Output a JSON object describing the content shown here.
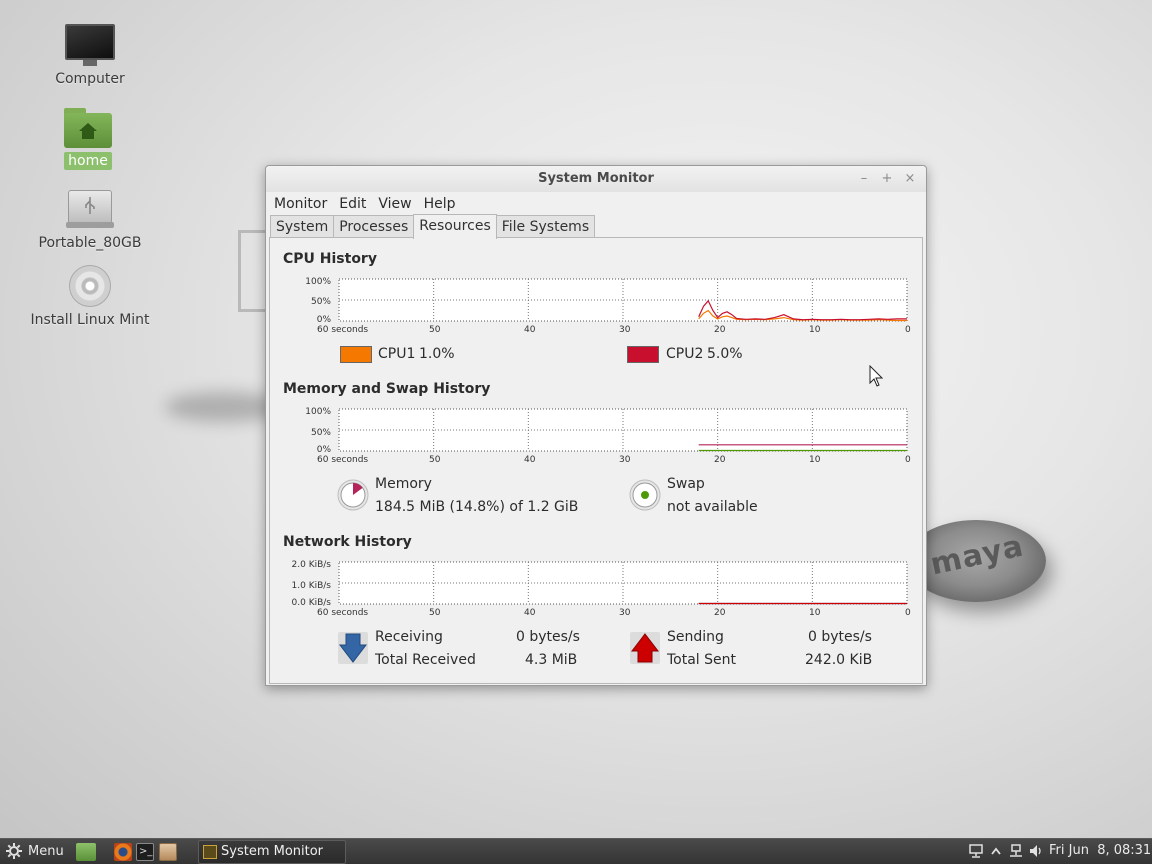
{
  "desktop": {
    "icons": [
      {
        "label": "Computer",
        "icon": "computer-icon"
      },
      {
        "label": "home",
        "icon": "home-folder-icon"
      },
      {
        "label": "Portable_80GB",
        "icon": "usb-drive-icon"
      },
      {
        "label": "Install Linux Mint",
        "icon": "disc-icon"
      }
    ],
    "wallpaper_logo_text": "maya"
  },
  "window": {
    "title": "System Monitor",
    "buttons": {
      "minimize": "–",
      "maximize": "+",
      "close": "×"
    },
    "menu": [
      "Monitor",
      "Edit",
      "View",
      "Help"
    ],
    "tabs": [
      "System",
      "Processes",
      "Resources",
      "File Systems"
    ],
    "active_tab": "Resources"
  },
  "resources": {
    "cpu": {
      "title": "CPU History",
      "y_ticks": [
        "100%",
        "50%",
        "0%"
      ],
      "x_ticks": [
        "60 seconds",
        "50",
        "40",
        "30",
        "20",
        "10",
        "0"
      ],
      "cpu1_label": "CPU1",
      "cpu1_value": "1.0%",
      "cpu2_label": "CPU2",
      "cpu2_value": "5.0%",
      "cpu1_color": "#f57900",
      "cpu2_color": "#c8102e"
    },
    "memory": {
      "title": "Memory and Swap History",
      "y_ticks": [
        "100%",
        "50%",
        "0%"
      ],
      "x_ticks": [
        "60 seconds",
        "50",
        "40",
        "30",
        "20",
        "10",
        "0"
      ],
      "memory_label": "Memory",
      "memory_value": "184.5 MiB (14.8%) of 1.2 GiB",
      "swap_label": "Swap",
      "swap_value": "not available",
      "memory_color": "#b4235a",
      "swap_color": "#4e9a06"
    },
    "network": {
      "title": "Network History",
      "y_ticks": [
        "2.0 KiB/s",
        "1.0 KiB/s",
        "0.0 KiB/s"
      ],
      "x_ticks": [
        "60 seconds",
        "50",
        "40",
        "30",
        "20",
        "10",
        "0"
      ],
      "receiving_label": "Receiving",
      "receiving_value": "0 bytes/s",
      "total_received_label": "Total Received",
      "total_received_value": "4.3 MiB",
      "sending_label": "Sending",
      "sending_value": "0 bytes/s",
      "total_sent_label": "Total Sent",
      "total_sent_value": "242.0 KiB",
      "receiving_color": "#3465a4",
      "sending_color": "#cc0000"
    }
  },
  "chart_data": [
    {
      "type": "line",
      "title": "CPU History",
      "x": [
        22,
        21.5,
        21,
        20.5,
        20,
        19.5,
        19,
        18.5,
        18,
        17,
        16,
        15,
        14,
        13,
        12,
        11,
        10,
        9,
        8,
        7,
        6,
        5,
        4,
        3,
        2,
        1,
        0
      ],
      "xlim": [
        60,
        0
      ],
      "ylim": [
        0,
        100
      ],
      "series": [
        {
          "name": "CPU1",
          "values": [
            5,
            18,
            25,
            12,
            5,
            10,
            12,
            8,
            4,
            3,
            4,
            3,
            5,
            8,
            3,
            2,
            3,
            2,
            2,
            3,
            2,
            2,
            2,
            3,
            2,
            1,
            1
          ]
        },
        {
          "name": "CPU2",
          "values": [
            10,
            35,
            48,
            25,
            8,
            18,
            22,
            15,
            6,
            4,
            5,
            4,
            8,
            15,
            5,
            3,
            4,
            3,
            3,
            4,
            3,
            3,
            4,
            5,
            4,
            5,
            5
          ]
        }
      ]
    },
    {
      "type": "line",
      "title": "Memory and Swap History",
      "x": [
        22,
        0
      ],
      "xlim": [
        60,
        0
      ],
      "ylim": [
        0,
        100
      ],
      "series": [
        {
          "name": "Memory",
          "values": [
            14.8,
            14.8
          ]
        },
        {
          "name": "Swap",
          "values": [
            0,
            0
          ]
        }
      ]
    },
    {
      "type": "line",
      "title": "Network History",
      "x": [
        22,
        0
      ],
      "xlim": [
        60,
        0
      ],
      "ylim": [
        0,
        2
      ],
      "series": [
        {
          "name": "Receiving",
          "values": [
            0,
            0
          ]
        },
        {
          "name": "Sending",
          "values": [
            0,
            0
          ]
        }
      ]
    }
  ],
  "taskbar": {
    "menu_label": "Menu",
    "task_label": "System Monitor",
    "clock": "Fri Jun  8, 08:31"
  }
}
